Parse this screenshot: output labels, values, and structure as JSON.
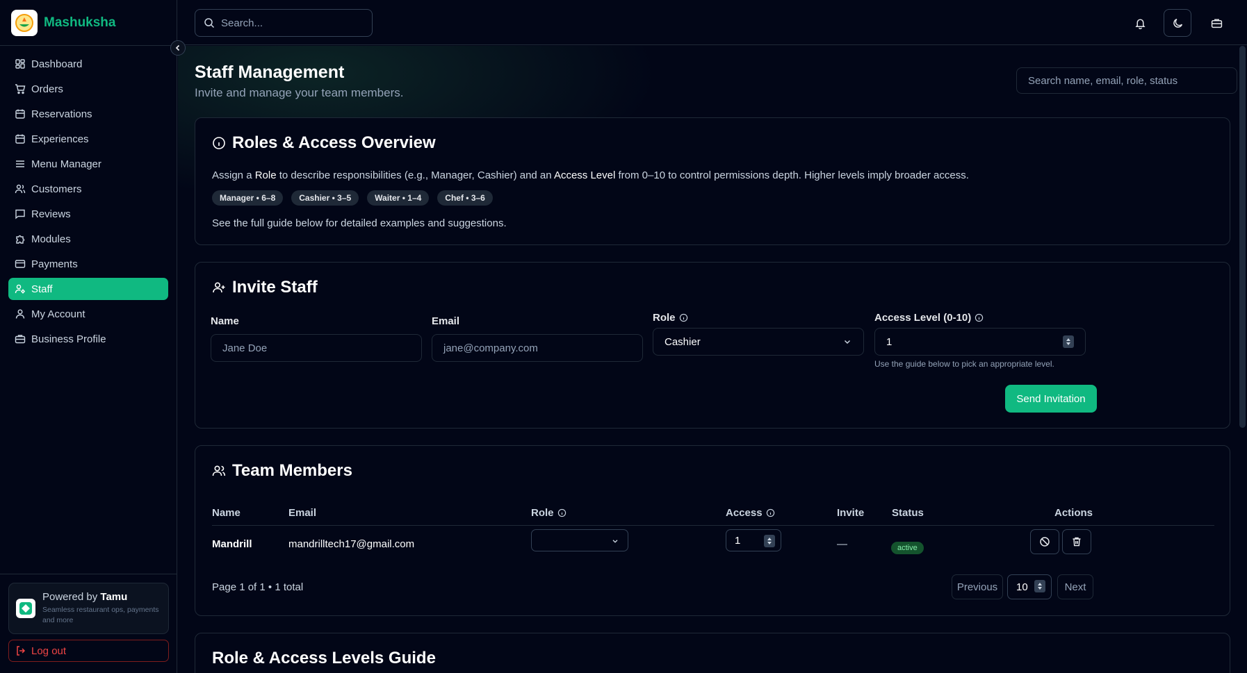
{
  "brand": {
    "name": "Mashuksha"
  },
  "sidebar": {
    "items": [
      {
        "label": "Dashboard",
        "icon": "dashboard-icon"
      },
      {
        "label": "Orders",
        "icon": "cart-icon"
      },
      {
        "label": "Reservations",
        "icon": "calendar-icon"
      },
      {
        "label": "Experiences",
        "icon": "calendar-icon"
      },
      {
        "label": "Menu Manager",
        "icon": "menu-icon"
      },
      {
        "label": "Customers",
        "icon": "users-icon"
      },
      {
        "label": "Reviews",
        "icon": "message-icon"
      },
      {
        "label": "Modules",
        "icon": "puzzle-icon"
      },
      {
        "label": "Payments",
        "icon": "credit-card-icon"
      },
      {
        "label": "Staff",
        "icon": "user-cog-icon",
        "active": true
      },
      {
        "label": "My Account",
        "icon": "user-icon"
      },
      {
        "label": "Business Profile",
        "icon": "briefcase-icon"
      }
    ],
    "powered_prefix": "Powered by",
    "powered_name": "Tamu",
    "powered_sub": "Seamless restaurant ops, payments and more",
    "logout": "Log out"
  },
  "topbar": {
    "search_placeholder": "Search..."
  },
  "page": {
    "title": "Staff Management",
    "subtitle": "Invite and manage your team members.",
    "search_placeholder": "Search name, email, role, status"
  },
  "overview": {
    "title": "Roles & Access Overview",
    "text_1": "Assign a ",
    "text_role": "Role",
    "text_2": " to describe responsibilities (e.g., Manager, Cashier) and an ",
    "text_access": "Access Level",
    "text_3": " from 0–10 to control permissions depth. Higher levels imply broader access.",
    "chips": [
      "Manager • 6–8",
      "Cashier • 3–5",
      "Waiter • 1–4",
      "Chef • 3–6"
    ],
    "footer": "See the full guide below for detailed examples and suggestions."
  },
  "invite": {
    "title": "Invite Staff",
    "name_label": "Name",
    "name_placeholder": "Jane Doe",
    "email_label": "Email",
    "email_placeholder": "jane@company.com",
    "role_label": "Role",
    "role_value": "Cashier",
    "access_label": "Access Level (0-10)",
    "access_value": "1",
    "hint": "Use the guide below to pick an appropriate level.",
    "send_label": "Send Invitation"
  },
  "team": {
    "title": "Team Members",
    "columns": {
      "name": "Name",
      "email": "Email",
      "role": "Role",
      "access": "Access",
      "invite": "Invite",
      "status": "Status",
      "actions": "Actions"
    },
    "rows": [
      {
        "name": "Mandrill",
        "email": "mandrilltech17@gmail.com",
        "role": "",
        "access": "1",
        "invite": "—",
        "status": "active"
      }
    ],
    "page_info": "Page 1 of 1 • 1 total",
    "previous": "Previous",
    "page_size": "10",
    "next": "Next"
  },
  "guide": {
    "title": "Role & Access Levels Guide"
  },
  "colors": {
    "accent": "#10b981",
    "background": "#020617",
    "danger": "#ef4444"
  }
}
